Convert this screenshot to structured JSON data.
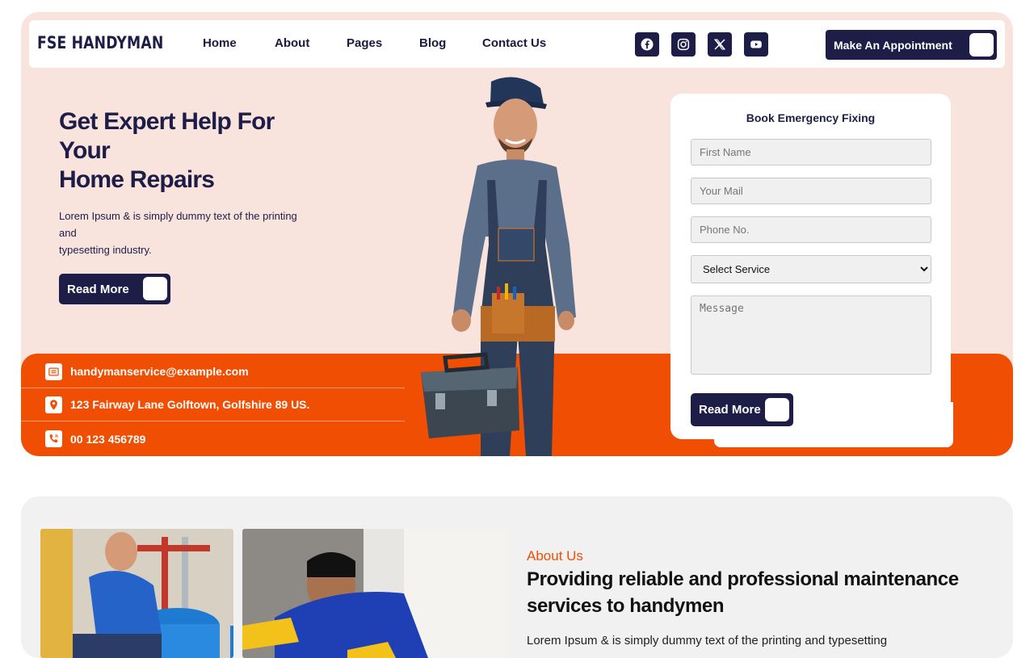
{
  "brand": {
    "logo_text": "FSE HANDYMAN"
  },
  "nav": {
    "links": [
      "Home",
      "About",
      "Pages",
      "Blog",
      "Contact Us"
    ],
    "socials": [
      "facebook-icon",
      "instagram-icon",
      "x-twitter-icon",
      "youtube-icon"
    ],
    "appointment_label": "Make An Appointment"
  },
  "hero": {
    "title_line1": "Get Expert Help For",
    "title_line2": "Your",
    "title_line3": "Home Repairs",
    "desc_line1": "Lorem Ipsum & is simply dummy text of the printing",
    "desc_line2": "and",
    "desc_line3": "typesetting industry.",
    "read_more_label": "Read More"
  },
  "contact": {
    "email": "handymanservice@example.com",
    "address": "123 Fairway Lane Golftown, Golfshire 89 US.",
    "phone": "00 123 456789"
  },
  "form": {
    "title": "Book Emergency Fixing",
    "first_name_placeholder": "First Name",
    "mail_placeholder": "Your Mail",
    "phone_placeholder": "Phone No.",
    "service_selected": "Select Service",
    "message_placeholder": "Message",
    "submit_label": "Read More"
  },
  "about": {
    "label": "About Us",
    "title": "Providing reliable and professional maintenance services to handymen",
    "desc": "Lorem Ipsum & is simply dummy text of the printing and typesetting"
  },
  "colors": {
    "navy": "#1d1d48",
    "orange": "#f04e03",
    "hero_bg": "#f8e3dd",
    "about_bg": "#f1f1f1"
  }
}
